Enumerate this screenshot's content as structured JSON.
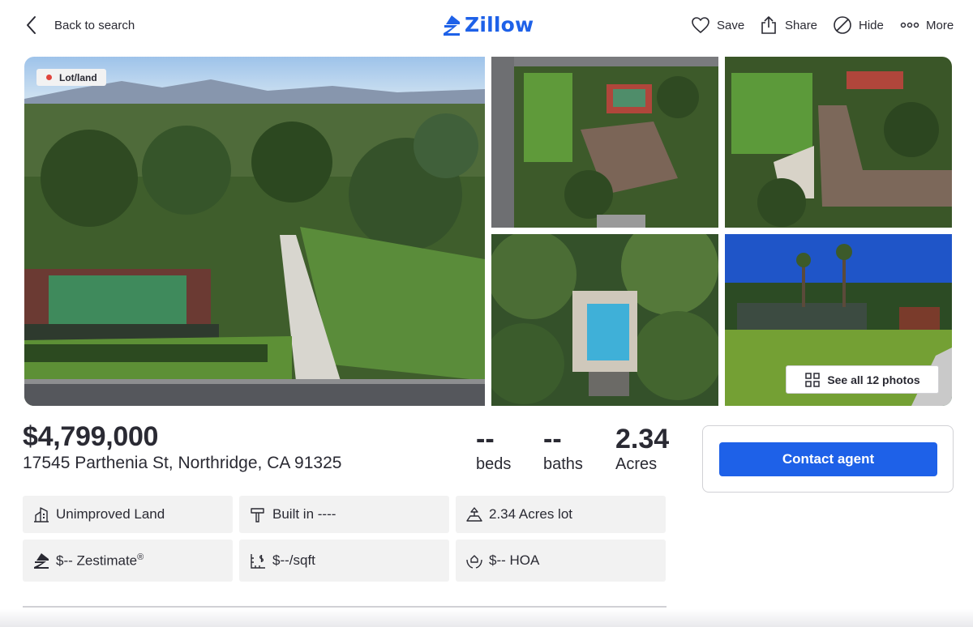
{
  "header": {
    "back_label": "Back to search",
    "logo_text": "Zillow",
    "save_label": "Save",
    "share_label": "Share",
    "hide_label": "Hide",
    "more_label": "More"
  },
  "gallery": {
    "badge": "Lot/land",
    "see_all_label": "See all 12 photos"
  },
  "listing": {
    "price": "$4,799,000",
    "address": "17545 Parthenia St, Northridge, CA 91325",
    "beds_value": "--",
    "beds_label": "beds",
    "baths_value": "--",
    "baths_label": "baths",
    "acres_value": "2.34",
    "acres_label": "Acres"
  },
  "contact": {
    "button_label": "Contact agent"
  },
  "facts": {
    "type": "Unimproved Land",
    "built": "Built in ----",
    "lot": "2.34 Acres lot",
    "zestimate": "$-- Zestimate",
    "zestimate_mark": "®",
    "price_sqft": "$--/sqft",
    "hoa": "$-- HOA"
  },
  "colors": {
    "brand_blue": "#1e61e8",
    "text": "#2a2a33",
    "chip_bg": "#f2f2f2",
    "badge_dot": "#e0443c"
  }
}
